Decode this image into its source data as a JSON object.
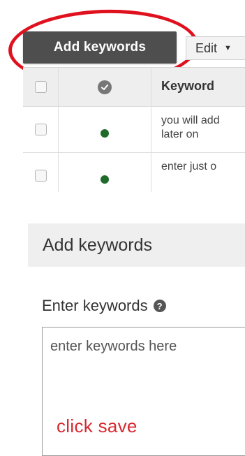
{
  "toolbar": {
    "add_keywords_label": "Add keywords",
    "edit_label": "Edit",
    "edit_caret_icon": "caret-down-icon"
  },
  "table": {
    "header": {
      "status_icon": "check-circle-icon",
      "keyword_label": "Keyword"
    },
    "rows": [
      {
        "keyword": "you will add\nlater on",
        "status": "enabled"
      },
      {
        "keyword": "enter just o",
        "status": "enabled"
      }
    ]
  },
  "form": {
    "title": "Add keywords",
    "field_label": "Enter keywords",
    "help_icon": "help-icon",
    "textarea_value": "enter keywords here",
    "annotation": "click save"
  },
  "colors": {
    "annotation_red": "#e0111e",
    "button_dark": "#4e4e4e",
    "status_green": "#1f6b2a"
  }
}
